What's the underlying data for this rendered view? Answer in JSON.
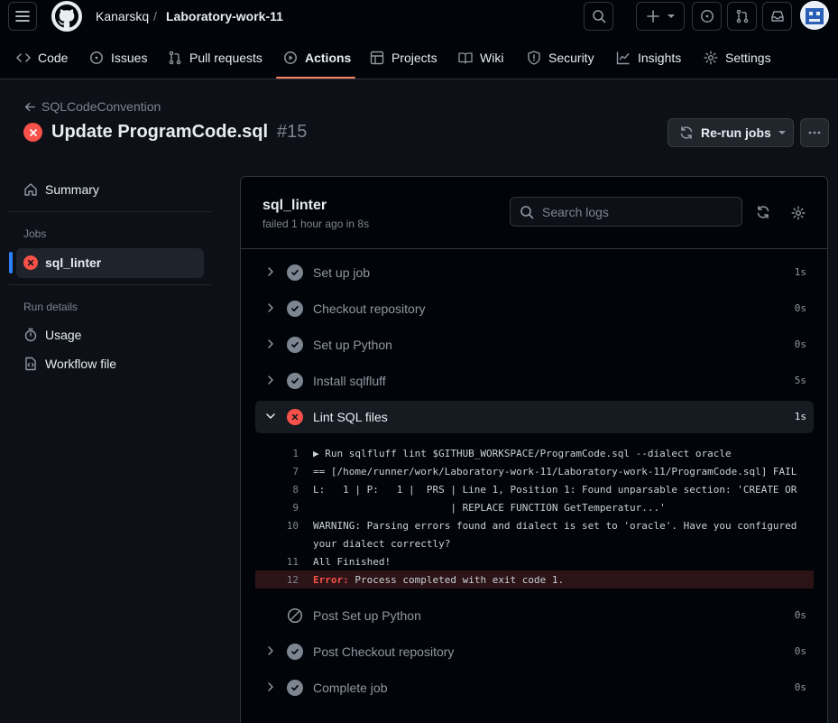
{
  "header": {
    "owner": "Kanarskq",
    "separator": "/",
    "repo": "Laboratory-work-11"
  },
  "nav": {
    "tabs": [
      {
        "label": "Code",
        "icon": "code-icon"
      },
      {
        "label": "Issues",
        "icon": "issue-icon"
      },
      {
        "label": "Pull requests",
        "icon": "pull-request-icon"
      },
      {
        "label": "Actions",
        "icon": "play-icon",
        "active": true
      },
      {
        "label": "Projects",
        "icon": "table-icon"
      },
      {
        "label": "Wiki",
        "icon": "book-icon"
      },
      {
        "label": "Security",
        "icon": "shield-icon"
      },
      {
        "label": "Insights",
        "icon": "graph-icon"
      },
      {
        "label": "Settings",
        "icon": "gear-icon"
      }
    ]
  },
  "run": {
    "workflow": "SQLCodeConvention",
    "title": "Update ProgramCode.sql",
    "number": "#15",
    "rerun_label": "Re-run jobs"
  },
  "sidebar": {
    "summary": "Summary",
    "jobs_heading": "Jobs",
    "job": "sql_linter",
    "run_details_heading": "Run details",
    "usage": "Usage",
    "workflow_file": "Workflow file"
  },
  "job": {
    "name": "sql_linter",
    "subtitle": "failed 1 hour ago in 8s",
    "search_placeholder": "Search logs",
    "steps": [
      {
        "name": "Set up job",
        "duration": "1s",
        "status": "success"
      },
      {
        "name": "Checkout repository",
        "duration": "0s",
        "status": "success"
      },
      {
        "name": "Set up Python",
        "duration": "0s",
        "status": "success"
      },
      {
        "name": "Install sqlfluff",
        "duration": "5s",
        "status": "success"
      },
      {
        "name": "Lint SQL files",
        "duration": "1s",
        "status": "failure",
        "expanded": true
      },
      {
        "name": "Post Set up Python",
        "duration": "0s",
        "status": "skipped"
      },
      {
        "name": "Post Checkout repository",
        "duration": "0s",
        "status": "success"
      },
      {
        "name": "Complete job",
        "duration": "0s",
        "status": "success"
      }
    ],
    "log": [
      {
        "n": "1",
        "text": "▶ Run sqlfluff lint $GITHUB_WORKSPACE/ProgramCode.sql --dialect oracle"
      },
      {
        "n": "7",
        "text": "== [/home/runner/work/Laboratory-work-11/Laboratory-work-11/ProgramCode.sql] FAIL"
      },
      {
        "n": "8",
        "text": "L:   1 | P:   1 |  PRS | Line 1, Position 1: Found unparsable section: 'CREATE OR"
      },
      {
        "n": "9",
        "text": "                       | REPLACE FUNCTION GetTemperatur...'"
      },
      {
        "n": "10",
        "text": "WARNING: Parsing errors found and dialect is set to 'oracle'. Have you configured"
      },
      {
        "n": "",
        "text": "your dialect correctly?"
      },
      {
        "n": "11",
        "text": "All Finished!"
      },
      {
        "n": "12",
        "error_label": "Error:",
        "text": " Process completed with exit code 1."
      }
    ]
  },
  "colors": {
    "background": "#0d1117",
    "failure": "#f85149",
    "active_tab_underline": "#f78166",
    "selected_marker": "#2f81f7"
  }
}
